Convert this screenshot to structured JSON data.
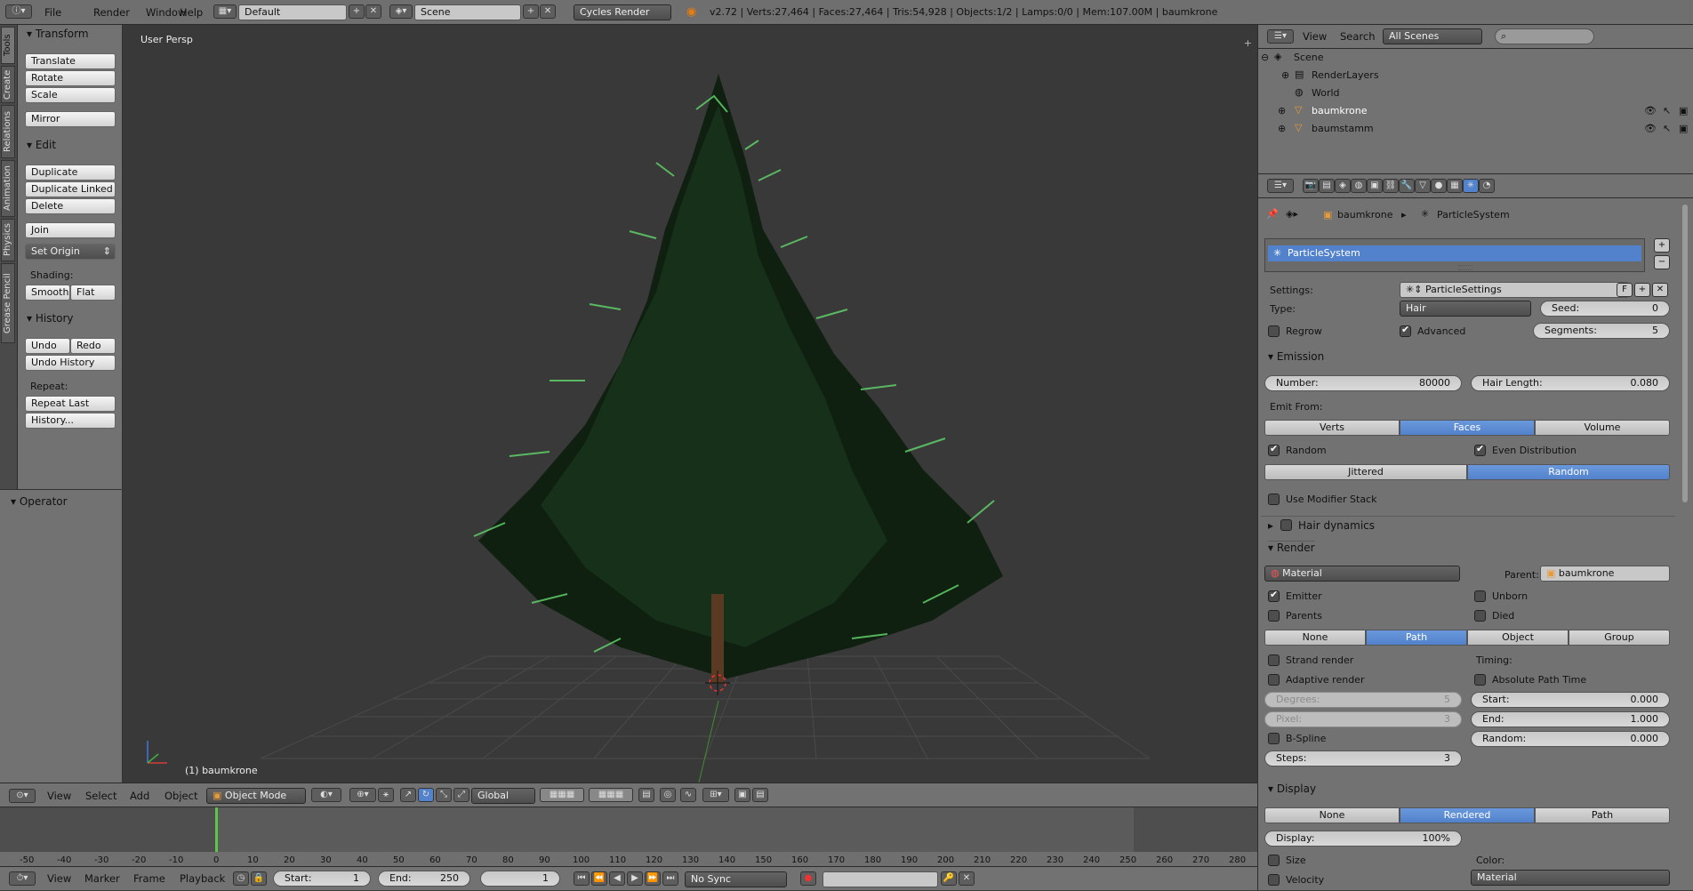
{
  "topbar": {
    "menus": [
      "File",
      "Render",
      "Window",
      "Help"
    ],
    "layout": "Default",
    "scene": "Scene",
    "engine": "Cycles Render",
    "stats": "v2.72 | Verts:27,464 | Faces:27,464 | Tris:54,928 | Objects:1/2 | Lamps:0/0 | Mem:107.00M | baumkrone"
  },
  "tabs": [
    "Tools",
    "Create",
    "Relations",
    "Animation",
    "Physics",
    "Grease Pencil"
  ],
  "tools": {
    "transform_header": "Transform",
    "translate": "Translate",
    "rotate": "Rotate",
    "scale": "Scale",
    "mirror": "Mirror",
    "edit_header": "Edit",
    "duplicate": "Duplicate",
    "duplicate_linked": "Duplicate Linked",
    "delete": "Delete",
    "join": "Join",
    "set_origin": "Set Origin",
    "shading_label": "Shading:",
    "smooth": "Smooth",
    "flat": "Flat",
    "history_header": "History",
    "undo": "Undo",
    "redo": "Redo",
    "undo_history": "Undo History",
    "repeat_label": "Repeat:",
    "repeat_last": "Repeat Last",
    "history_btn": "History...",
    "operator_header": "Operator"
  },
  "viewport": {
    "persp": "User Persp",
    "object_label": "(1) baumkrone"
  },
  "vp_header": {
    "menus": [
      "View",
      "Select",
      "Add",
      "Object"
    ],
    "mode": "Object Mode",
    "orientation": "Global"
  },
  "timeline": {
    "ticks": [
      "-50",
      "-40",
      "-30",
      "-20",
      "-10",
      "0",
      "10",
      "20",
      "30",
      "40",
      "50",
      "60",
      "70",
      "80",
      "90",
      "100",
      "110",
      "120",
      "130",
      "140",
      "150",
      "160",
      "170",
      "180",
      "190",
      "200",
      "210",
      "220",
      "230",
      "240",
      "250",
      "260",
      "270",
      "280"
    ],
    "current_frame": "1",
    "start_label": "Start:",
    "start": "1",
    "end_label": "End:",
    "end": "250",
    "sync": "No Sync",
    "menus": [
      "View",
      "Marker",
      "Frame",
      "Playback"
    ]
  },
  "outliner": {
    "menus": [
      "View",
      "Search"
    ],
    "filter": "All Scenes",
    "items": [
      "Scene",
      "RenderLayers",
      "World",
      "baumkrone",
      "baumstamm"
    ]
  },
  "props": {
    "breadcrumb_obj": "baumkrone",
    "breadcrumb_ps": "ParticleSystem",
    "list_item": "ParticleSystem",
    "settings_label": "Settings:",
    "settings_value": "ParticleSettings",
    "settings_f": "F",
    "type_label": "Type:",
    "type_value": "Hair",
    "seed_label": "Seed:",
    "seed": "0",
    "regrow": "Regrow",
    "advanced": "Advanced",
    "segments_label": "Segments:",
    "segments": "5",
    "emission": "Emission",
    "number_label": "Number:",
    "number": "80000",
    "hair_length_label": "Hair Length:",
    "hair_length": "0.080",
    "emit_from": "Emit From:",
    "verts": "Verts",
    "faces": "Faces",
    "volume": "Volume",
    "random": "Random",
    "even_distribution": "Even Distribution",
    "jittered": "Jittered",
    "random2": "Random",
    "use_modifier_stack": "Use Modifier Stack",
    "hair_dynamics": "Hair dynamics",
    "render": "Render",
    "material": "Material",
    "parent_label": "Parent:",
    "parent": "baumkrone",
    "emitter": "Emitter",
    "unborn": "Unborn",
    "parents": "Parents",
    "died": "Died",
    "none": "None",
    "path": "Path",
    "object": "Object",
    "group": "Group",
    "strand_render": "Strand render",
    "timing": "Timing:",
    "adaptive_render": "Adaptive render",
    "absolute_path_time": "Absolute Path Time",
    "degrees_label": "Degrees:",
    "degrees": "5",
    "start_label": "Start:",
    "start": "0.000",
    "pixel_label": "Pixel:",
    "pixel": "3",
    "end_label": "End:",
    "end": "1.000",
    "bspline": "B-Spline",
    "random_label": "Random:",
    "random_val": "0.000",
    "steps_label": "Steps:",
    "steps": "3",
    "display": "Display",
    "d_none": "None",
    "d_rendered": "Rendered",
    "d_path": "Path",
    "display_label": "Display:",
    "display_val": "100%",
    "size": "Size",
    "color_label": "Color:",
    "velocity": "Velocity",
    "color_value": "Material"
  }
}
